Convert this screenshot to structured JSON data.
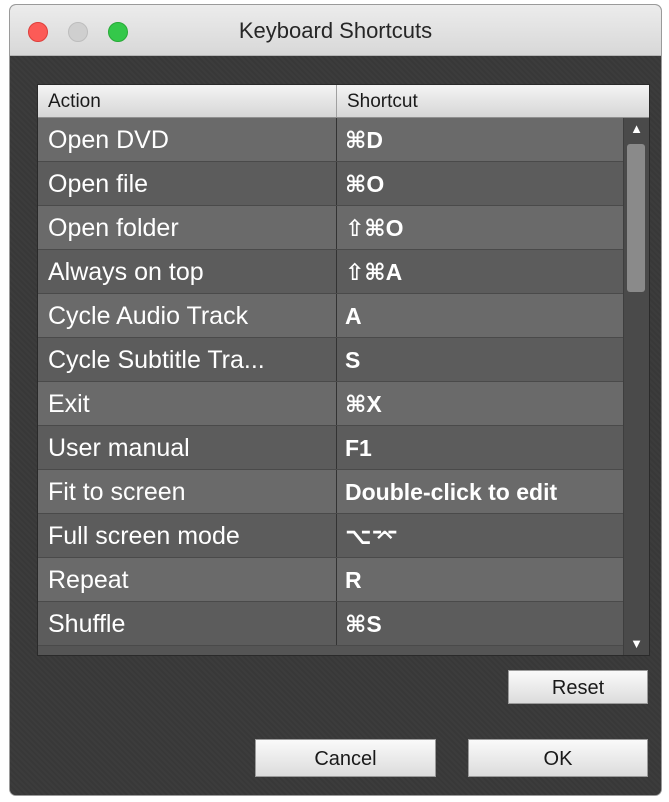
{
  "window": {
    "title": "Keyboard Shortcuts"
  },
  "table": {
    "headers": {
      "action": "Action",
      "shortcut": "Shortcut"
    },
    "rows": [
      {
        "action": "Open DVD",
        "shortcut": "⌘D"
      },
      {
        "action": "Open file",
        "shortcut": "⌘O"
      },
      {
        "action": "Open folder",
        "shortcut": "⇧⌘O"
      },
      {
        "action": "Always on top",
        "shortcut": "⇧⌘A"
      },
      {
        "action": "Cycle Audio Track",
        "shortcut": "A"
      },
      {
        "action": "Cycle Subtitle Tra...",
        "shortcut": "S"
      },
      {
        "action": "Exit",
        "shortcut": "⌘X"
      },
      {
        "action": "User manual",
        "shortcut": "F1"
      },
      {
        "action": "Fit to screen",
        "shortcut": "Double-click to edit"
      },
      {
        "action": "Full screen mode",
        "shortcut": "⌥⌤"
      },
      {
        "action": "Repeat",
        "shortcut": "R"
      },
      {
        "action": "Shuffle",
        "shortcut": "⌘S"
      }
    ]
  },
  "buttons": {
    "reset": "Reset",
    "cancel": "Cancel",
    "ok": "OK"
  },
  "icons": {
    "close": "close-traffic-light",
    "minimize": "minimize-traffic-light",
    "zoom": "zoom-traffic-light",
    "scroll_up": "▲",
    "scroll_down": "▼"
  },
  "colors": {
    "close": "#fc5b57",
    "minimize": "#cfcfcf",
    "zoom": "#34c84a",
    "row_odd": "#6a6a6a",
    "row_even": "#5c5c5c"
  }
}
